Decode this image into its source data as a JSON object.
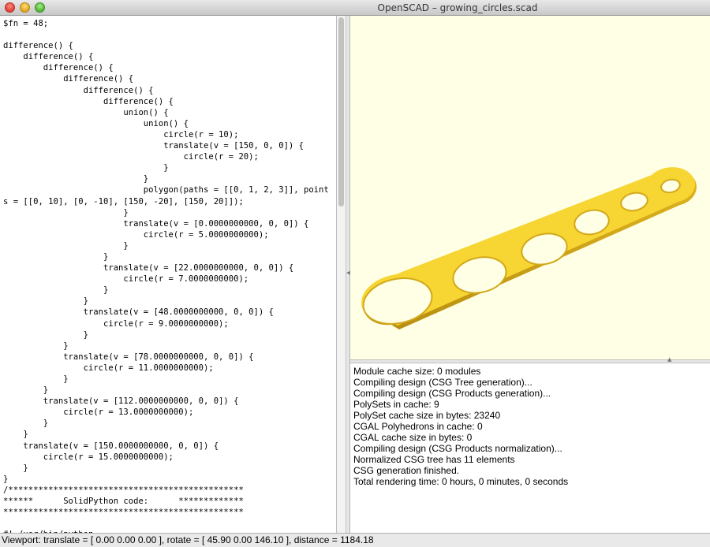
{
  "window": {
    "title": "OpenSCAD – growing_circles.scad"
  },
  "editor": {
    "code": "$fn = 48;\n\ndifference() {\n    difference() {\n        difference() {\n            difference() {\n                difference() {\n                    difference() {\n                        union() {\n                            union() {\n                                circle(r = 10);\n                                translate(v = [150, 0, 0]) {\n                                    circle(r = 20);\n                                }\n                            }\n                            polygon(paths = [[0, 1, 2, 3]], point\ns = [[0, 10], [0, -10], [150, -20], [150, 20]]);\n                        }\n                        translate(v = [0.0000000000, 0, 0]) {\n                            circle(r = 5.0000000000);\n                        }\n                    }\n                    translate(v = [22.0000000000, 0, 0]) {\n                        circle(r = 7.0000000000);\n                    }\n                }\n                translate(v = [48.0000000000, 0, 0]) {\n                    circle(r = 9.0000000000);\n                }\n            }\n            translate(v = [78.0000000000, 0, 0]) {\n                circle(r = 11.0000000000);\n            }\n        }\n        translate(v = [112.0000000000, 0, 0]) {\n            circle(r = 13.0000000000);\n        }\n    }\n    translate(v = [150.0000000000, 0, 0]) {\n        circle(r = 15.0000000000);\n    }\n}\n/***********************************************\n******      SolidPython code:      *************\n************************************************\n\n#! /usr/bin/python"
  },
  "viewer": {
    "background": "#ffffe5",
    "shape_fill": "#f7d533",
    "shape_edge": "#d2a91a",
    "hole_fill": "#ffffe5"
  },
  "console": {
    "lines": [
      "Module cache size: 0 modules",
      "Compiling design (CSG Tree generation)...",
      "Compiling design (CSG Products generation)...",
      "PolySets in cache: 9",
      "PolySet cache size in bytes: 23240",
      "CGAL Polyhedrons in cache: 0",
      "CGAL cache size in bytes: 0",
      "Compiling design (CSG Products normalization)...",
      "Normalized CSG tree has 11 elements",
      "CSG generation finished.",
      "Total rendering time: 0 hours, 0 minutes, 0 seconds"
    ]
  },
  "status": {
    "text": "Viewport: translate = [ 0.00 0.00 0.00 ], rotate = [ 45.90 0.00 146.10 ], distance = 1184.18"
  }
}
